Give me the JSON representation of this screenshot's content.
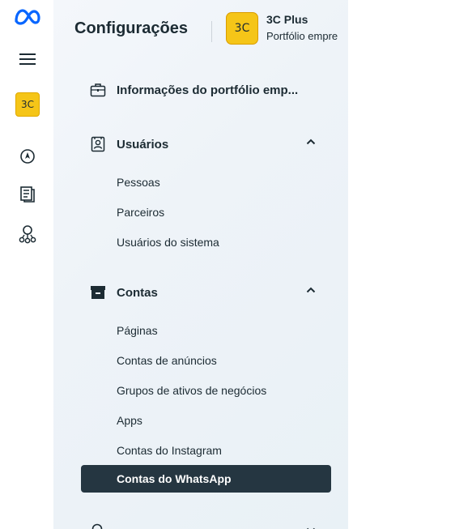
{
  "rail": {
    "logo_icon": "meta-logo",
    "items": [
      {
        "icon": "hamburger-menu-icon"
      },
      {
        "icon": "business-badge",
        "label": "3C"
      },
      {
        "icon": "compass-icon"
      },
      {
        "icon": "pages-icon"
      },
      {
        "icon": "people-icon"
      }
    ]
  },
  "header": {
    "title": "Configurações",
    "business_badge": "3C",
    "business_name": "3C Plus",
    "business_subtitle": "Portfólio empre"
  },
  "sections": {
    "info": {
      "label": "Informações do portfólio emp...",
      "icon": "briefcase-icon"
    },
    "users": {
      "label": "Usuários",
      "icon": "id-card-icon",
      "chevron": "^",
      "items": [
        "Pessoas",
        "Parceiros",
        "Usuários do sistema"
      ]
    },
    "accounts": {
      "label": "Contas",
      "icon": "archive-box-icon",
      "chevron": "^",
      "items": [
        "Páginas",
        "Contas de anúncios",
        "Grupos de ativos de negócios",
        "Apps",
        "Contas do Instagram",
        "Contas do WhatsApp"
      ],
      "active_item": "Contas do WhatsApp"
    },
    "data_sources": {
      "icon": "search-icon",
      "chevron": "v"
    }
  },
  "colors": {
    "active_bg": "#253641",
    "brand_yellow": "#f5c518",
    "meta_blue": "#0866ff",
    "text": "#1c2b33"
  }
}
